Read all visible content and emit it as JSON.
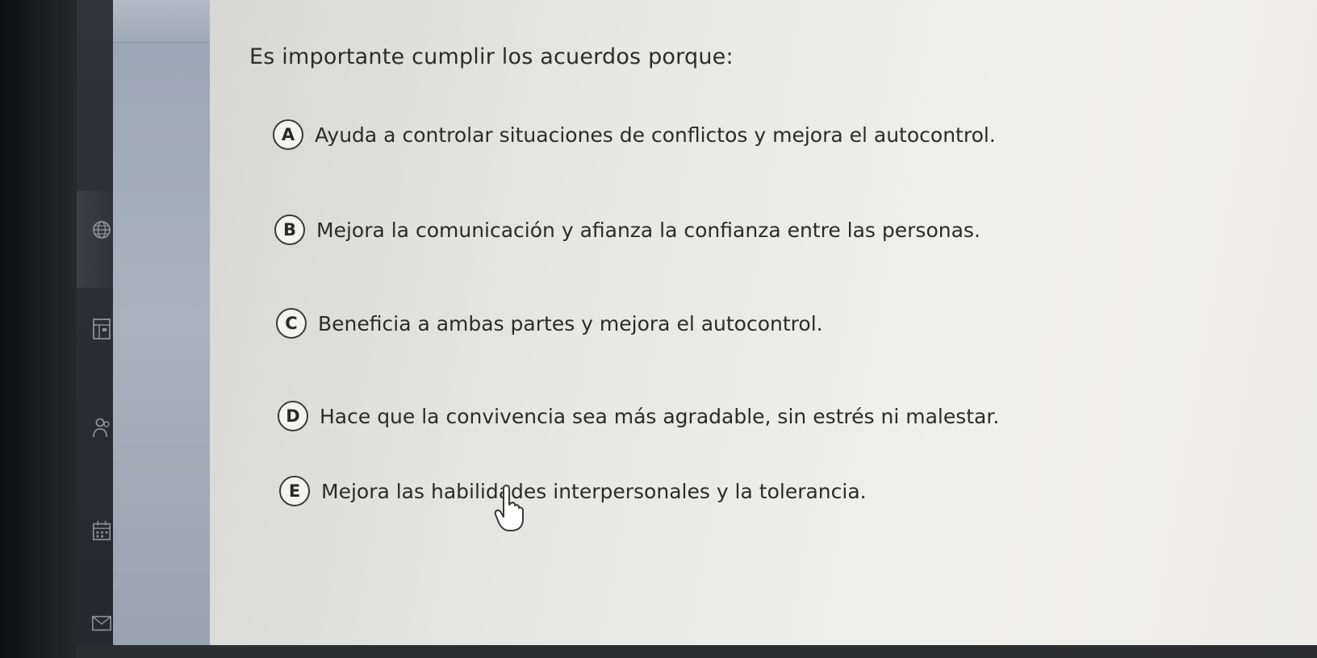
{
  "question": "Es importante cumplir los acuerdos porque:",
  "options": [
    {
      "letter": "A",
      "text": "Ayuda a controlar situaciones de conflictos y mejora el autocontrol."
    },
    {
      "letter": "B",
      "text": "Mejora la comunicación y afianza la confianza entre las personas."
    },
    {
      "letter": "C",
      "text": "Beneficia a ambas partes y mejora el autocontrol."
    },
    {
      "letter": "D",
      "text": "Hace que la convivencia sea más agradable, sin estrés ni malestar."
    },
    {
      "letter": "E",
      "text": "Mejora las habilidades interpersonales y la tolerancia."
    }
  ],
  "sidebar_icons": [
    "globe-icon",
    "layout-icon",
    "people-icon",
    "calendar-icon",
    "mail-icon"
  ],
  "colors": {
    "sidebar": "#2a2e34",
    "panel": "#a4aebc",
    "content_bg": "#e8e8e6",
    "text": "#2b2b2b"
  }
}
